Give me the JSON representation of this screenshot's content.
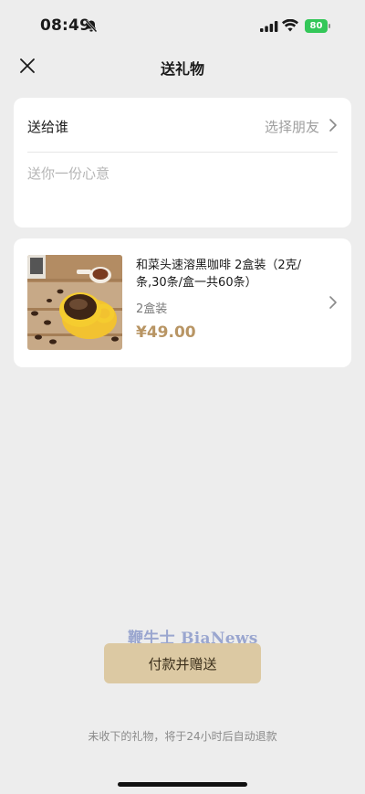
{
  "status_bar": {
    "time": "08:49",
    "battery_level": "80",
    "icons": [
      "bell-muted-icon",
      "signal-icon",
      "wifi-icon",
      "battery-icon"
    ],
    "battery_color": "#34c759"
  },
  "nav": {
    "title": "送礼物",
    "close_icon": "close-icon"
  },
  "recipient": {
    "label": "送给谁",
    "placeholder": "选择朋友",
    "message_placeholder": "送你一份心意"
  },
  "product": {
    "title": "和菜头速溶黑咖啡 2盒装（2克/条,30条/盒一共60条）",
    "spec": "2盒装",
    "price": "¥49.00",
    "price_color": "#b89564"
  },
  "watermark": "鞭牛士 BiaNews",
  "actions": {
    "pay_label": "付款并赠送",
    "pay_color": "#dcc9a3"
  },
  "footer": {
    "refund_note": "未收下的礼物，将于24小时后自动退款"
  }
}
